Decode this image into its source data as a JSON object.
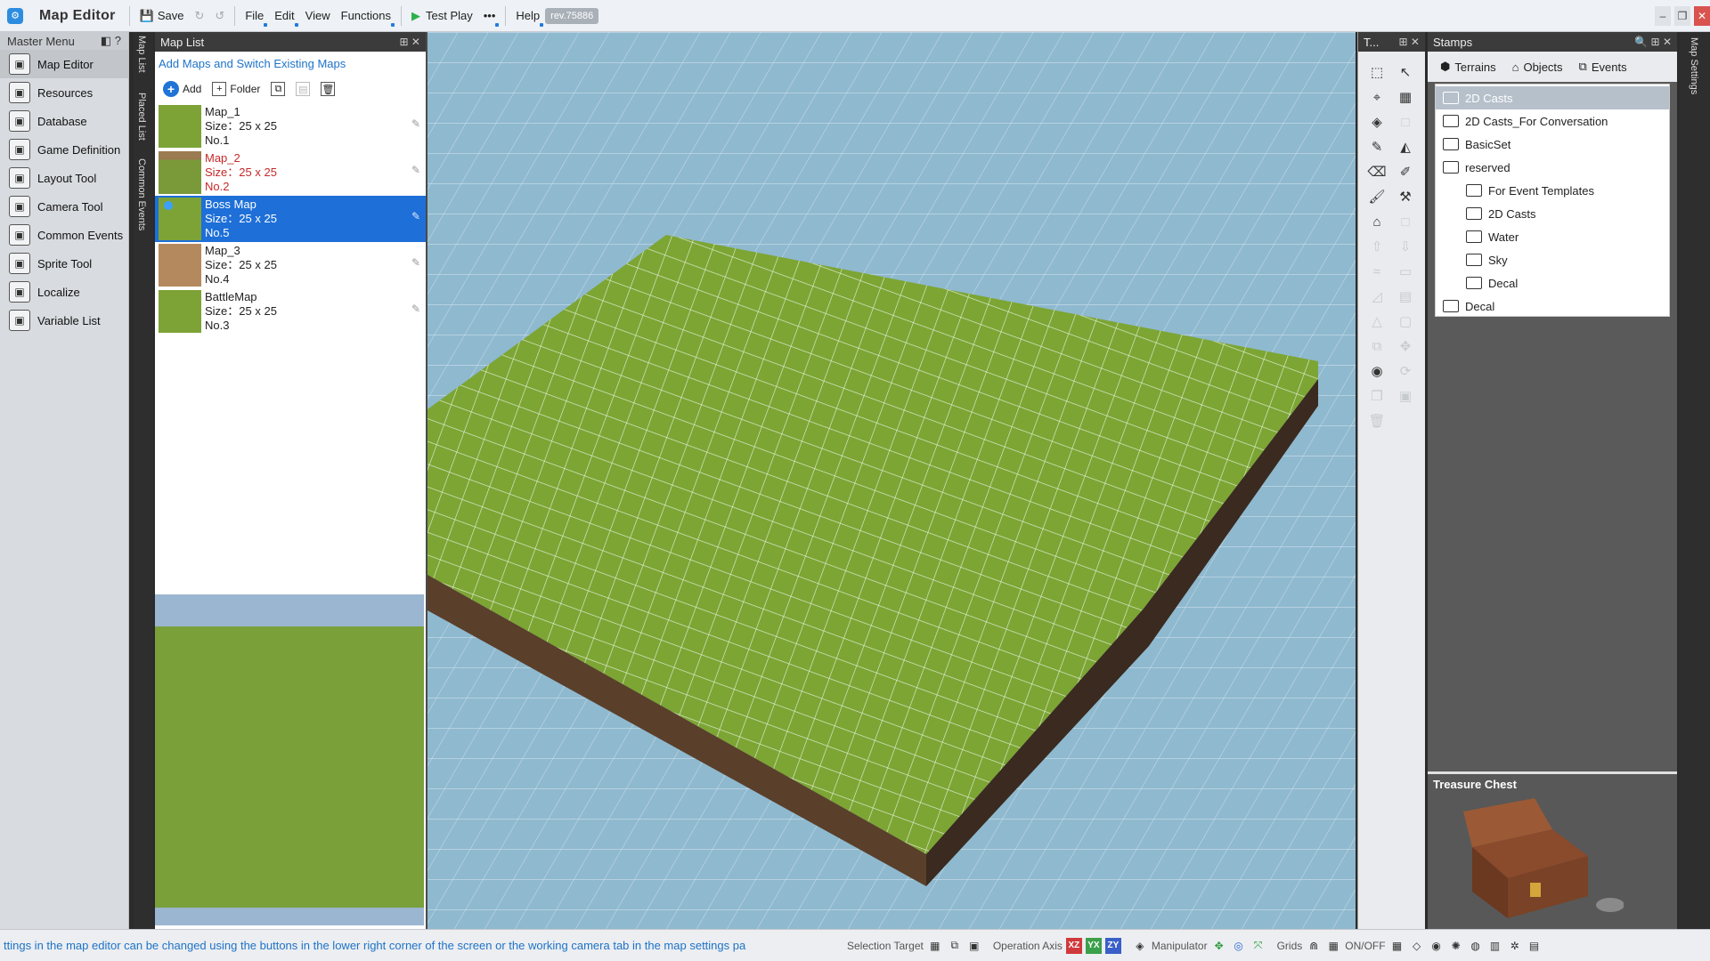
{
  "app": {
    "title": "Map Editor",
    "revision": "rev.75886"
  },
  "toolbar": {
    "save": "Save",
    "file": "File",
    "edit": "Edit",
    "view": "View",
    "functions": "Functions",
    "test_play": "Test Play",
    "more": "•••",
    "help": "Help"
  },
  "master_menu": {
    "title": "Master Menu",
    "items": [
      {
        "label": "Map Editor",
        "icon": "map-icon"
      },
      {
        "label": "Resources",
        "icon": "resources-icon"
      },
      {
        "label": "Database",
        "icon": "database-icon"
      },
      {
        "label": "Game Definition",
        "icon": "gear-icon"
      },
      {
        "label": "Layout Tool",
        "icon": "layout-icon"
      },
      {
        "label": "Camera Tool",
        "icon": "camera-icon"
      },
      {
        "label": "Common Events",
        "icon": "events-icon"
      },
      {
        "label": "Sprite Tool",
        "icon": "sprite-icon"
      },
      {
        "label": "Localize",
        "icon": "localize-icon"
      },
      {
        "label": "Variable List",
        "icon": "variable-icon"
      }
    ]
  },
  "side_tabs": [
    "Map List",
    "Placed List",
    "Common Events"
  ],
  "map_list": {
    "title": "Map List",
    "description": "Add Maps and Switch Existing Maps",
    "add": "Add",
    "folder": "Folder",
    "maps": [
      {
        "name": "Map_1",
        "size": "Size：25 x 25",
        "no": "No.1"
      },
      {
        "name": "Map_2",
        "size": "Size：25 x 25",
        "no": "No.2"
      },
      {
        "name": "Boss Map",
        "size": "Size：25 x 25",
        "no": "No.5"
      },
      {
        "name": "Map_3",
        "size": "Size：25 x 25",
        "no": "No.4"
      },
      {
        "name": "BattleMap",
        "size": "Size：25 x 25",
        "no": "No.3"
      }
    ]
  },
  "tools_title": "T...",
  "stamps": {
    "title": "Stamps",
    "tabs": [
      "Terrains",
      "Objects",
      "Events"
    ],
    "tree": [
      {
        "label": "2D Casts",
        "level": 0
      },
      {
        "label": "2D Casts_For Conversation",
        "level": 0
      },
      {
        "label": "BasicSet",
        "level": 0
      },
      {
        "label": "reserved",
        "level": 0
      },
      {
        "label": "For Event Templates",
        "level": 1
      },
      {
        "label": "2D Casts",
        "level": 1
      },
      {
        "label": "Water",
        "level": 1
      },
      {
        "label": "Sky",
        "level": 1
      },
      {
        "label": "Decal",
        "level": 1
      },
      {
        "label": "Decal",
        "level": 0
      }
    ],
    "preview_title": "Treasure Chest"
  },
  "right_tab": "Map Settings",
  "status": {
    "message": "ttings in the map editor can be changed using the buttons in the lower right corner of the screen or the working camera tab in the map settings pa",
    "selection_target": "Selection Target",
    "operation_axis": "Operation Axis",
    "axes": [
      "XZ",
      "YX",
      "ZY"
    ],
    "manipulator": "Manipulator",
    "grids": "Grids",
    "onoff": "ON/OFF"
  },
  "colors": {
    "accent": "#1e6fd8",
    "grass": "#7da336",
    "sky": "#8fb9cf"
  }
}
